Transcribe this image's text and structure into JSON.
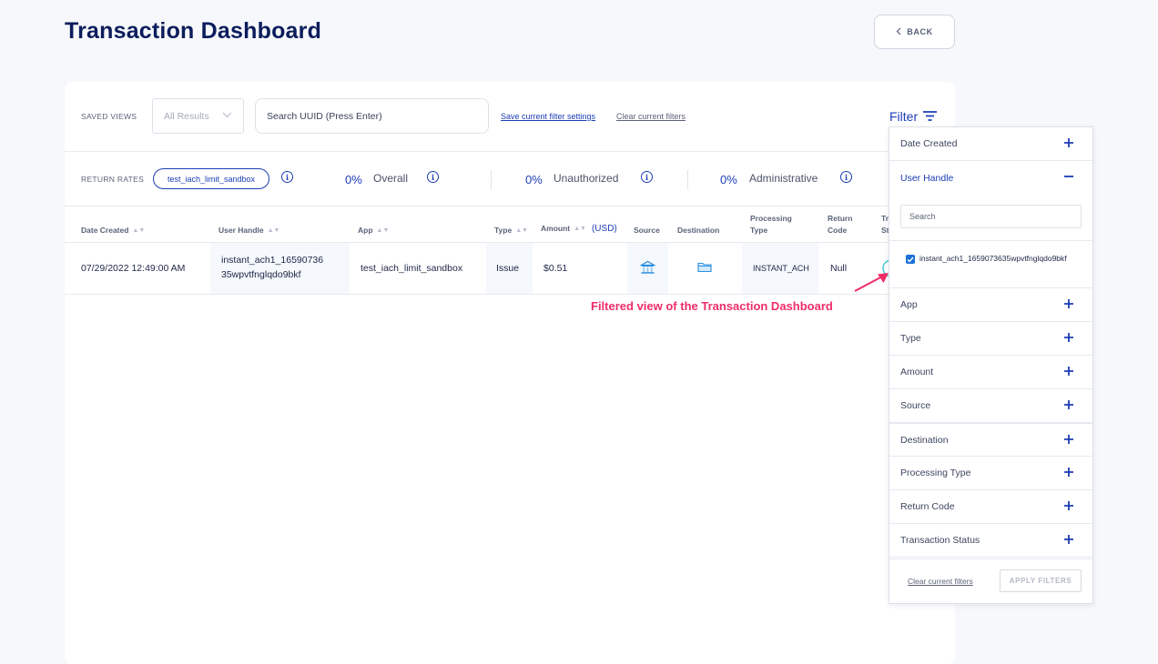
{
  "header": {
    "title": "Transaction Dashboard",
    "back_label": "BACK"
  },
  "toolbar": {
    "saved_views_label": "SAVED VIEWS",
    "saved_views_value": "All Results",
    "search_placeholder": "Search UUID (Press Enter)",
    "save_filter_link": "Save current filter settings",
    "clear_filter_link": "Clear current filters",
    "filter_label": "Filter"
  },
  "return_rates": {
    "label": "RETURN RATES",
    "chip": "test_iach_limit_sandbox",
    "rates": [
      {
        "value": "0%",
        "name": "Overall"
      },
      {
        "value": "0%",
        "name": "Unauthorized"
      },
      {
        "value": "0%",
        "name": "Administrative"
      }
    ]
  },
  "table": {
    "headers": {
      "date_created": "Date Created",
      "user_handle": "User Handle",
      "app": "App",
      "type": "Type",
      "amount": "Amount",
      "amount_unit": "(USD)",
      "source": "Source",
      "destination": "Destination",
      "processing_type_1": "Processing",
      "processing_type_2": "Type",
      "return_code_1": "Return",
      "return_code_2": "Code",
      "status_1": "Tr",
      "status_2": "St"
    },
    "rows": [
      {
        "date_created": "07/29/2022 12:49:00 AM",
        "user_handle_1": "instant_ach1_16590736",
        "user_handle_2": "35wpvtfnglqdo9bkf",
        "app": "test_iach_limit_sandbox",
        "type": "Issue",
        "amount": "$0.51",
        "source_icon": "bank-icon",
        "destination_icon": "folder-icon",
        "processing_type": "INSTANT_ACH",
        "return_code": "Null"
      }
    ]
  },
  "annotation": "Filtered view of the Transaction Dashboard",
  "filter_panel": {
    "sections": [
      "Date Created",
      "User Handle",
      "App",
      "Type",
      "Amount",
      "Source",
      "Destination",
      "Processing Type",
      "Return Code",
      "Transaction Status"
    ],
    "search_placeholder": "Search",
    "checkbox_label": "instant_ach1_1659073635wpvtfnglqdo9bkf",
    "clear_link": "Clear current filters",
    "apply_label": "APPLY FILTERS"
  },
  "colors": {
    "accent": "#1c3db5",
    "annotation": "#ee2d67",
    "title": "#0c1d5c"
  }
}
